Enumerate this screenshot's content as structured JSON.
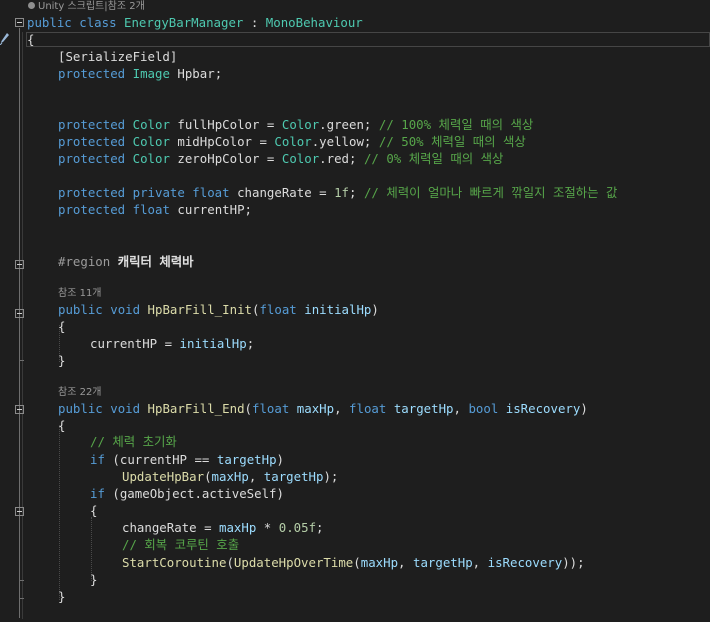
{
  "header_lens": {
    "unity": "Unity 스크립트",
    "sep": "|",
    "refs": "참조 2개"
  },
  "class_decl": {
    "kw_public": "public",
    "kw_class": "class",
    "name": "EnergyBarManager",
    "colon": ":",
    "base": "MonoBehaviour"
  },
  "open_brace": "{",
  "close_brace": "}",
  "attr_line": {
    "text": "[SerializeField]"
  },
  "hpbar_line": {
    "mod": "protected",
    "type": "Image",
    "name": "Hpbar;"
  },
  "full_line": {
    "mod": "protected",
    "type": "Color",
    "name": "fullHpColor",
    "eq": "=",
    "cls": "Color",
    "prop": ".green;",
    "comment_prefix": "// ",
    "num": "100%",
    "comment": " 체력일 때의 색상"
  },
  "mid_line": {
    "mod": "protected",
    "type": "Color",
    "name": "midHpColor",
    "eq": "=",
    "cls": "Color",
    "prop": ".yellow;",
    "comment_prefix": "// ",
    "num": "50%",
    "comment": " 체력일 때의 색상"
  },
  "zero_line": {
    "mod": "protected",
    "type": "Color",
    "name": "zeroHpColor",
    "eq": "=",
    "cls": "Color",
    "prop": ".red;",
    "comment_prefix": "// ",
    "num": "0%",
    "comment": " 체력일 때의 색상"
  },
  "rate_line": {
    "mod": "protected",
    "mod2": "private",
    "type": "float",
    "name": "changeRate",
    "eq": "=",
    "num": "1f",
    "semi": ";",
    "comment": "// 체력이 얼마나 빠르게 깎일지 조절하는 값"
  },
  "cur_line": {
    "mod": "protected",
    "type": "float",
    "name": "currentHP;"
  },
  "region_line": {
    "kw": "#region",
    "name": "캐릭터 체력바"
  },
  "lens_init": "참조 11개",
  "init_decl": {
    "mod": "public",
    "type": "void",
    "name": "HpBarFill_Init",
    "open": "(",
    "ptype": "float",
    "pname": "initialHp",
    "close": ")"
  },
  "init_body": {
    "name": "currentHP",
    "eq": "=",
    "param": "initialHp",
    "semi": ";"
  },
  "lens_end": "참조 22개",
  "end_decl": {
    "mod": "public",
    "type": "void",
    "name": "HpBarFill_End",
    "open": "(",
    "t1": "float",
    "p1": "maxHp",
    "comma1": ",",
    "t2": "float",
    "p2": "targetHp",
    "comma2": ",",
    "t3": "bool",
    "p3": "isRecovery",
    "close": ")"
  },
  "end_comment1": "// 체력 초기화",
  "if1": {
    "kw": "if",
    "open": "(",
    "name": "currentHP",
    "op": "==",
    "param": "targetHp",
    "close": ")"
  },
  "update_call": {
    "fn": "UpdateHpBar",
    "open": "(",
    "p1": "maxHp",
    "comma": ",",
    "p2": "targetHp",
    "close": ");"
  },
  "if2": {
    "kw": "if",
    "text": "(gameObject.activeSelf)"
  },
  "rate_assign": {
    "name": "changeRate",
    "eq": "=",
    "param": "maxHp",
    "op": "*",
    "num": "0.05f",
    "semi": ";"
  },
  "end_comment2": "// 회복 코루틴 호출",
  "start_call": {
    "fn": "StartCoroutine",
    "open": "(",
    "fn2": "UpdateHpOverTime",
    "open2": "(",
    "p1": "maxHp",
    "comma1": ",",
    "p2": "targetHp",
    "comma2": ",",
    "p3": "isRecovery",
    "close": "));"
  }
}
